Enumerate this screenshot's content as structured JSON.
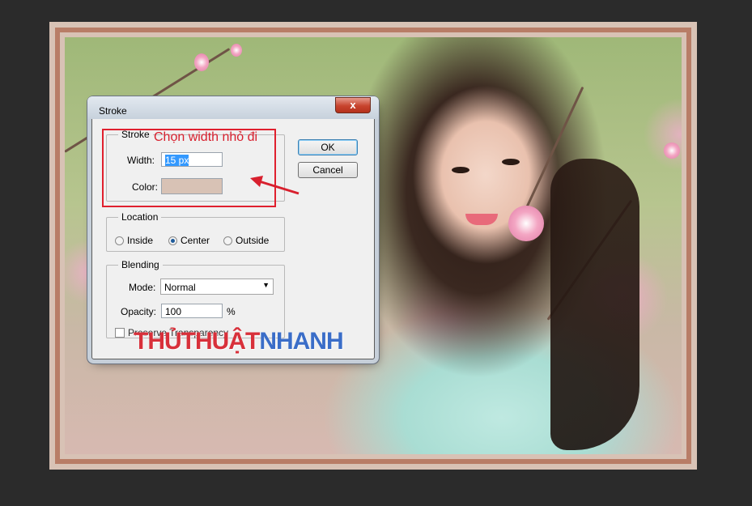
{
  "dialog": {
    "title": "Stroke",
    "close_glyph": "x",
    "ok_label": "OK",
    "cancel_label": "Cancel",
    "stroke_group": {
      "legend": "Stroke",
      "width_label": "Width:",
      "width_value": "15 px",
      "color_label": "Color:",
      "color_swatch": "#d8c2b5"
    },
    "location_group": {
      "legend": "Location",
      "options": [
        "Inside",
        "Center",
        "Outside"
      ],
      "selected": "Center"
    },
    "blending_group": {
      "legend": "Blending",
      "mode_label": "Mode:",
      "mode_value": "Normal",
      "opacity_label": "Opacity:",
      "opacity_value": "100",
      "opacity_unit": "%",
      "preserve_label": "Preserve Transparency",
      "preserve_checked": false
    }
  },
  "annotation": {
    "text": "Chọn width nhỏ đi",
    "color": "#d8202e"
  },
  "watermark": {
    "part1": "THỦTHUẬT",
    "part2": "NHANH"
  },
  "colors": {
    "workspace": "#2b2b2b",
    "stroke_outer": "#d8c2b5",
    "stroke_inner": "#b87d67"
  }
}
